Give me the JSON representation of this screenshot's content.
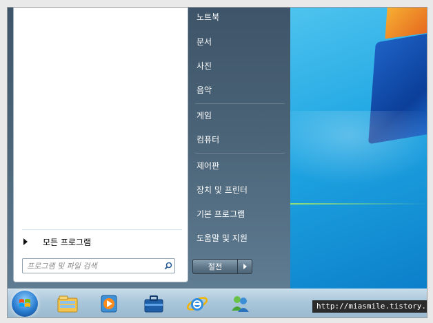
{
  "start_menu": {
    "all_programs_label": "모든 프로그램",
    "search_placeholder": "프로그램 및 파일 검색",
    "right_items": [
      {
        "label": "노트북"
      },
      {
        "label": "문서"
      },
      {
        "label": "사진"
      },
      {
        "label": "음악"
      },
      {
        "label": "게임"
      },
      {
        "label": "컴퓨터"
      },
      {
        "label": "제어판"
      },
      {
        "label": "장치 및 프린터"
      },
      {
        "label": "기본 프로그램"
      },
      {
        "label": "도움말 및 지원"
      }
    ],
    "shutdown_label": "절전"
  },
  "taskbar": {
    "icons": [
      "start-orb-icon",
      "windows-explorer-icon",
      "media-player-icon",
      "briefcase-icon",
      "internet-explorer-icon",
      "messenger-icon"
    ]
  },
  "watermark_text": "http://miasmile.tistory.com",
  "colors": {
    "accent_blue": "#1fa6e3",
    "menu_dark": "#3e5469",
    "taskbar": "#a9c6da"
  }
}
